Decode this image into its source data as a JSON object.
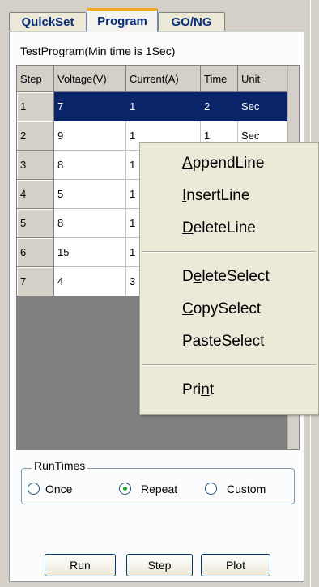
{
  "tabs": [
    {
      "label": "QuickSet"
    },
    {
      "label": "Program"
    },
    {
      "label": "GO/NG"
    }
  ],
  "test_program": {
    "title": "TestProgram(Min time is 1Sec)"
  },
  "table": {
    "columns": [
      "Step",
      "Voltage(V)",
      "Current(A)",
      "Time",
      "Unit"
    ],
    "rows": [
      {
        "step": "1",
        "voltage": "7",
        "current": "1",
        "time": "2",
        "unit": "Sec"
      },
      {
        "step": "2",
        "voltage": "9",
        "current": "1",
        "time": "1",
        "unit": "Sec"
      },
      {
        "step": "3",
        "voltage": "8",
        "current": "1",
        "time": "",
        "unit": ""
      },
      {
        "step": "4",
        "voltage": "5",
        "current": "1",
        "time": "",
        "unit": ""
      },
      {
        "step": "5",
        "voltage": "8",
        "current": "1",
        "time": "",
        "unit": ""
      },
      {
        "step": "6",
        "voltage": "15",
        "current": "1",
        "time": "",
        "unit": ""
      },
      {
        "step": "7",
        "voltage": "4",
        "current": "3",
        "time": "",
        "unit": ""
      }
    ],
    "selected_row": 0
  },
  "context_menu": {
    "items": [
      {
        "label": "AppendLine",
        "ul": "A",
        "rest": "ppendLine"
      },
      {
        "label": "InsertLine",
        "ul": "I",
        "rest": "nsertLine"
      },
      {
        "label": "DeleteLine",
        "ul": "D",
        "rest": "eleteLine"
      },
      {
        "label": "DeleteSelect",
        "pre": "D",
        "ul": "e",
        "rest": "leteSelect"
      },
      {
        "label": "CopySelect",
        "ul": "C",
        "rest": "opySelect"
      },
      {
        "label": "PasteSelect",
        "ul": "P",
        "rest": "asteSelect"
      },
      {
        "label": "Print",
        "pre": "Pri",
        "ul": "n",
        "rest": "t"
      }
    ]
  },
  "run_times": {
    "legend": "RunTimes",
    "options": [
      "Once",
      "Repeat",
      "Custom"
    ],
    "selected": "Repeat"
  },
  "buttons": {
    "run": "Run",
    "step": "Step",
    "plot": "Plot"
  },
  "colors": {
    "selection": "#0a246a",
    "tab_accent": "#f5a623",
    "radio_dot": "#21a121"
  }
}
